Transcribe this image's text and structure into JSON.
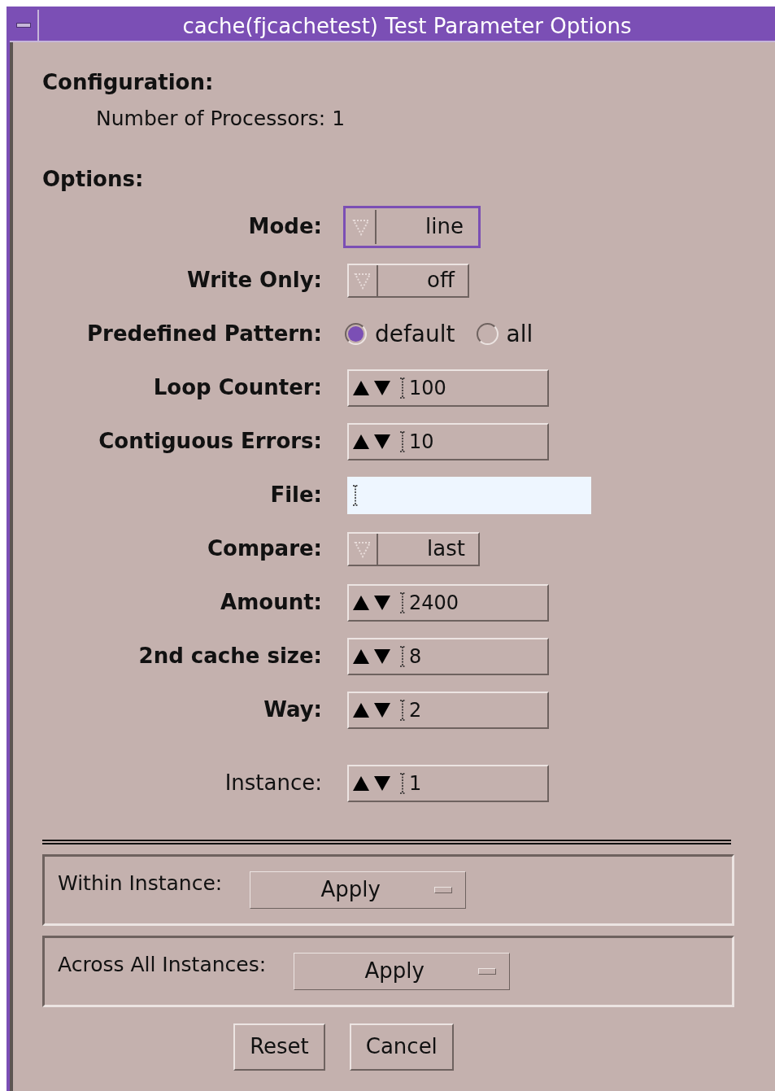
{
  "window": {
    "title": "cache(fjcachetest) Test Parameter Options"
  },
  "configuration": {
    "heading": "Configuration:",
    "line": "Number of Processors: 1"
  },
  "options": {
    "heading": "Options:",
    "fields": [
      {
        "kind": "menu",
        "label": "Mode:",
        "bold": true,
        "value": "line",
        "focused": true
      },
      {
        "kind": "menu",
        "label": "Write Only:",
        "bold": true,
        "value": "off",
        "focused": false
      },
      {
        "kind": "radio",
        "label": "Predefined Pattern:",
        "bold": true,
        "choices": [
          {
            "label": "default",
            "selected": true
          },
          {
            "label": "all",
            "selected": false
          }
        ]
      },
      {
        "kind": "spinner",
        "label": "Loop Counter:",
        "bold": true,
        "value": "100"
      },
      {
        "kind": "spinner",
        "label": "Contiguous Errors:",
        "bold": true,
        "value": "10"
      },
      {
        "kind": "text",
        "label": "File:",
        "bold": true
      },
      {
        "kind": "menu",
        "label": "Compare:",
        "bold": true,
        "value": "last",
        "focused": false
      },
      {
        "kind": "spinner",
        "label": "Amount:",
        "bold": true,
        "value": "2400"
      },
      {
        "kind": "spinner",
        "label": "2nd cache size:",
        "bold": true,
        "value": "8"
      },
      {
        "kind": "spinner",
        "label": "Way:",
        "bold": true,
        "value": "2"
      },
      {
        "kind": "spinner",
        "label": "Instance:",
        "bold": false,
        "value": "1"
      }
    ]
  },
  "apply_groups": [
    {
      "label": "Within Instance:",
      "button": "Apply"
    },
    {
      "label": "Across All Instances:",
      "button": "Apply"
    }
  ],
  "buttons": [
    "Reset",
    "Cancel"
  ]
}
